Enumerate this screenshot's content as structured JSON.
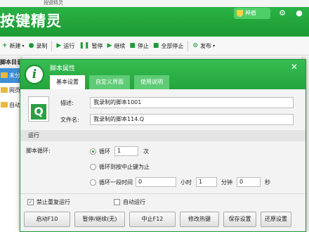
{
  "app": {
    "title": "按键精灵",
    "vip_label": "神盾",
    "top_strip_text": "按键精灵"
  },
  "toolbar": {
    "new_label": "新建",
    "record_label": "录制",
    "run_label": "运行",
    "pause_label": "暂停",
    "continue_label": "继续",
    "stop_label": "停止",
    "stop_all_label": "全部停止",
    "publish_label": "发布"
  },
  "sidebar": {
    "header": "脚本目录",
    "items": [
      {
        "label": "未分类"
      },
      {
        "label": "网页"
      },
      {
        "label": "自动"
      }
    ]
  },
  "dialog": {
    "title": "脚本属性",
    "tabs": [
      {
        "label": "基本设置"
      },
      {
        "label": "自定义界面"
      },
      {
        "label": "使用说明"
      }
    ],
    "desc_label": "描述:",
    "desc_value": "我录制的脚本1001",
    "filename_label": "文件名:",
    "filename_value": "我录制的脚本114.Q",
    "run_section": "运行",
    "loop_label": "脚本循环:",
    "loop_opt1": "循环",
    "loop_count": "1",
    "loop_unit": "次",
    "loop_opt2": "循环到按中止键为止",
    "loop_opt3": "循环一段时间",
    "hours_value": "0",
    "hours_unit": "小时",
    "minutes_value": "1",
    "minutes_unit": "分钟",
    "seconds_value": "0",
    "seconds_unit": "秒",
    "no_repeat_label": "禁止重复运行",
    "auto_run_label": "自动运行",
    "buttons": {
      "start": "启动F10",
      "pause_continue": "暂停/继续(无)",
      "abort": "中止F12",
      "hotkey": "修改热键",
      "save": "保存设置",
      "restore": "还原设置"
    }
  },
  "colors": {
    "brand_green": "#24a43d",
    "selection_blue": "#3d8fd6"
  }
}
